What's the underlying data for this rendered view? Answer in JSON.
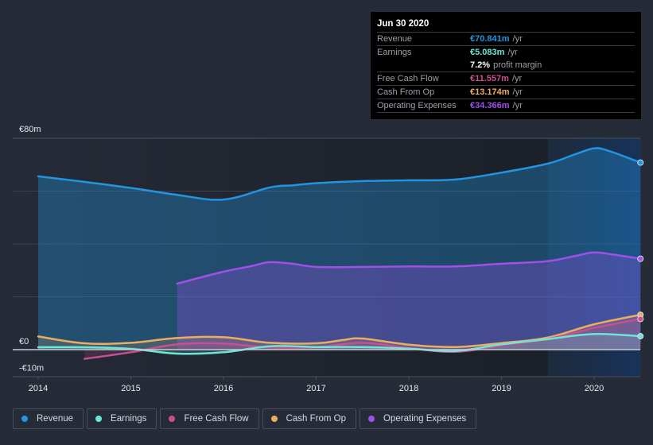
{
  "tooltip": {
    "date": "Jun 30 2020",
    "rows": [
      {
        "label": "Revenue",
        "value": "€70.841m",
        "unit": "/yr",
        "color": "#2394df"
      },
      {
        "label": "Earnings",
        "value": "€5.083m",
        "unit": "/yr",
        "color": "#6ce5d6"
      },
      {
        "label": "",
        "value": "7.2%",
        "unit": "profit margin",
        "color": "#ffffff"
      },
      {
        "label": "Free Cash Flow",
        "value": "€11.557m",
        "unit": "/yr",
        "color": "#c94f8f"
      },
      {
        "label": "Cash From Op",
        "value": "€13.174m",
        "unit": "/yr",
        "color": "#eaae62"
      },
      {
        "label": "Operating Expenses",
        "value": "€34.366m",
        "unit": "/yr",
        "color": "#a050e8"
      }
    ]
  },
  "legend": [
    {
      "label": "Revenue",
      "color": "#2394df"
    },
    {
      "label": "Earnings",
      "color": "#6ce5d6"
    },
    {
      "label": "Free Cash Flow",
      "color": "#c94f8f"
    },
    {
      "label": "Cash From Op",
      "color": "#eaae62"
    },
    {
      "label": "Operating Expenses",
      "color": "#a050e8"
    }
  ],
  "chart_data": {
    "type": "area",
    "title": "",
    "xlabel": "",
    "ylabel": "",
    "xlim": [
      2013.7,
      2020.5
    ],
    "ylim": [
      -10,
      80
    ],
    "y_tick_labels": [
      {
        "value": 80,
        "label": "€80m"
      },
      {
        "value": 0,
        "label": "€0"
      },
      {
        "value": -10,
        "label": "-€10m"
      }
    ],
    "x_ticks": [
      2014,
      2015,
      2016,
      2017,
      2018,
      2019,
      2020
    ],
    "x_tick_labels": [
      "2014",
      "2015",
      "2016",
      "2017",
      "2018",
      "2019",
      "2020"
    ],
    "grid": true,
    "gridlines": [
      0,
      20,
      40,
      60,
      80
    ],
    "highlight_from": 2019.5,
    "legend_position": "bottom-left",
    "series": [
      {
        "name": "Revenue",
        "color": "#2394df",
        "x": [
          2014.0,
          2014.5,
          2015.0,
          2015.5,
          2016.0,
          2016.5,
          2016.75,
          2017.0,
          2017.5,
          2018.0,
          2018.5,
          2019.0,
          2019.5,
          2019.8,
          2020.0,
          2020.15,
          2020.5
        ],
        "y": [
          65.6,
          63.5,
          61.2,
          58.6,
          56.8,
          61.4,
          62.2,
          63.0,
          63.8,
          64.1,
          64.4,
          67.0,
          70.4,
          74.0,
          76.2,
          75.3,
          70.8
        ]
      },
      {
        "name": "Operating Expenses",
        "color": "#a050e8",
        "x": [
          2015.5,
          2016.0,
          2016.3,
          2016.5,
          2016.75,
          2017.0,
          2017.5,
          2018.0,
          2018.5,
          2019.0,
          2019.5,
          2019.8,
          2020.0,
          2020.2,
          2020.5
        ],
        "y": [
          25.0,
          29.5,
          31.6,
          33.1,
          32.5,
          31.3,
          31.3,
          31.5,
          31.5,
          32.5,
          33.5,
          35.5,
          36.8,
          36.0,
          34.4
        ]
      },
      {
        "name": "Cash From Op",
        "color": "#eaae62",
        "x": [
          2014.0,
          2014.5,
          2015.0,
          2015.5,
          2016.0,
          2016.5,
          2017.0,
          2017.3,
          2017.5,
          2018.0,
          2018.5,
          2019.0,
          2019.5,
          2020.0,
          2020.5
        ],
        "y": [
          5.0,
          2.4,
          2.6,
          4.4,
          4.7,
          2.6,
          2.4,
          3.7,
          4.2,
          1.9,
          1.0,
          2.5,
          4.6,
          9.6,
          13.2
        ]
      },
      {
        "name": "Free Cash Flow",
        "color": "#c94f8f",
        "x": [
          2014.5,
          2015.0,
          2015.5,
          2016.0,
          2016.5,
          2017.0,
          2017.5,
          2018.0,
          2018.5,
          2019.0,
          2019.5,
          2020.0,
          2020.5
        ],
        "y": [
          -3.5,
          -1.0,
          2.0,
          2.3,
          0.8,
          0.9,
          2.6,
          0.6,
          -0.8,
          1.6,
          4.0,
          8.2,
          11.6
        ]
      },
      {
        "name": "Earnings",
        "color": "#6ce5d6",
        "x": [
          2014.0,
          2014.5,
          2015.0,
          2015.5,
          2016.0,
          2016.5,
          2017.0,
          2017.5,
          2018.0,
          2018.5,
          2019.0,
          2019.5,
          2020.0,
          2020.5
        ],
        "y": [
          0.9,
          0.9,
          0.3,
          -1.5,
          -1.0,
          1.3,
          1.0,
          1.0,
          0.4,
          -0.5,
          2.0,
          4.0,
          5.9,
          5.1
        ]
      }
    ]
  }
}
